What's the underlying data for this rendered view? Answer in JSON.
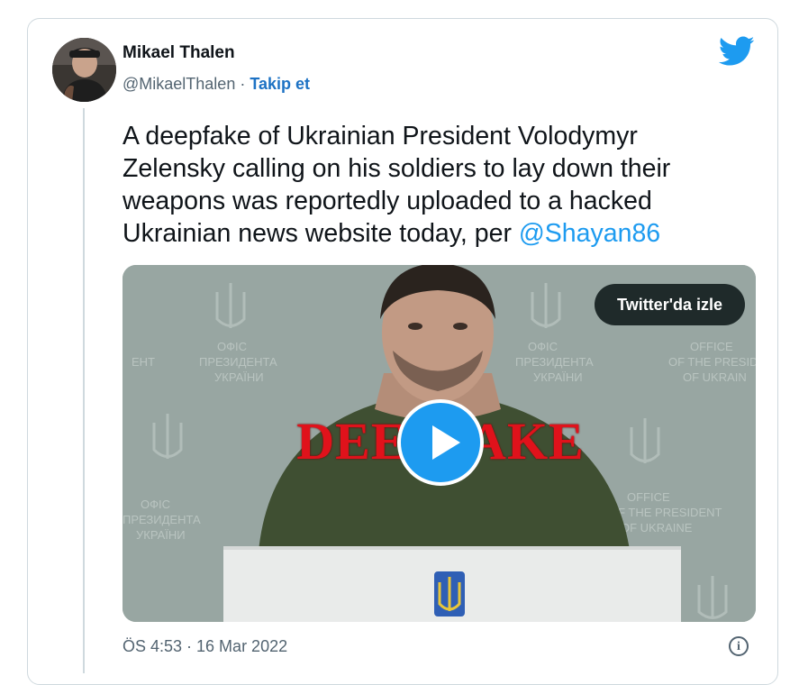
{
  "tweet": {
    "author_name": "Mikael Thalen",
    "author_handle": "@MikaelThalen",
    "separator": " · ",
    "follow_label": "Takip et",
    "text_before_mention": "A deepfake of Ukrainian President Volodymyr Zelensky calling on his soldiers to lay down their weapons was reportedly uploaded to a hacked Ukrainian news website today, per ",
    "mention": "@Shayan86",
    "timestamp": "ÖS 4:53 · 16 Mar 2022",
    "info_glyph": "i"
  },
  "media": {
    "watch_label": "Twitter'da izle",
    "overlay_text": "DEEPFAKE",
    "background_lettering": "ОФІС ПРЕЗИДЕНТА УКРАЇНИ"
  },
  "colors": {
    "link_blue": "#1d9bf0",
    "follow_blue": "#1d72c4",
    "deepfake_red": "#e0121b"
  },
  "icons": [
    "twitter-bird-icon",
    "play-icon",
    "info-icon",
    "ukraine-trident-icon"
  ]
}
